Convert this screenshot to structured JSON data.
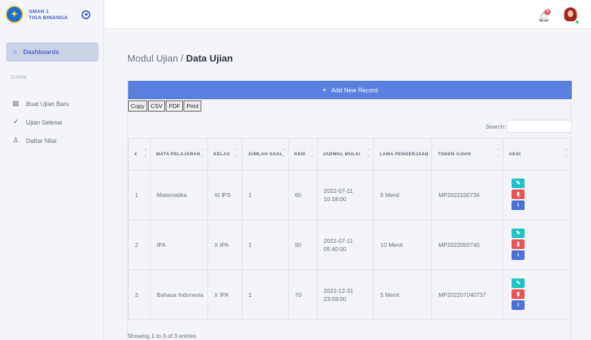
{
  "brand": {
    "line1": "SMAN 1",
    "line2": "TIGA BINANGA"
  },
  "sidebar": {
    "active": {
      "label": "Dashboards",
      "icon": "home-icon"
    },
    "section": "UJIAN",
    "items": [
      {
        "label": "Buat Ujian Baru",
        "icon": "notepad-icon"
      },
      {
        "label": "Ujian Selesai",
        "icon": "check-circle-icon"
      },
      {
        "label": "Daftar Nilai",
        "icon": "user-icon"
      }
    ]
  },
  "topbar": {
    "notification_count": "5"
  },
  "breadcrumb": {
    "parent": "Modul Ujian / ",
    "current": "Data Ujian"
  },
  "toolbar": {
    "add_label": "Add New Record"
  },
  "export": {
    "copy": "Copy",
    "csv": "CSV",
    "pdf": "PDF",
    "print": "Print"
  },
  "search": {
    "label": "Search:",
    "value": ""
  },
  "table": {
    "headers": {
      "no": "#",
      "mapel": "MATA PELAJARAN",
      "kelas": "KELAS",
      "soal": "JUMLAH SOAL",
      "kkm": "KKM",
      "jadwal": "JADWAL MULAI",
      "lama": "LAMA PENGERJAAN",
      "token": "TOKEN UJIAN",
      "aksi": "AKSI"
    },
    "rows": [
      {
        "no": "1",
        "mapel": "Matematika",
        "kelas": "XI IPS",
        "soal": "1",
        "kkm": "60",
        "jadwal_date": "2022-07-11",
        "jadwal_time": "10:18:00",
        "lama": "5 Menit",
        "token": "MP2022100734"
      },
      {
        "no": "2",
        "mapel": "IPA",
        "kelas": "X IPA",
        "soal": "1",
        "kkm": "90",
        "jadwal_date": "2022-07-11",
        "jadwal_time": "05:40:00",
        "lama": "10 Menit",
        "token": "MP2022050740"
      },
      {
        "no": "3",
        "mapel": "Bahasa Indonesia",
        "kelas": "X IPA",
        "soal": "1",
        "kkm": "70",
        "jadwal_date": "2022-12-31",
        "jadwal_time": "23:59:00",
        "lama": "5 Menit",
        "token": "MP202207040737"
      }
    ]
  },
  "footer": {
    "info": "Showing 1 to 3 of 3 entries"
  },
  "colors": {
    "accent": "#5b7fdc",
    "edit": "#1fc3c8",
    "delete": "#ea5455",
    "info": "#4c6fd8"
  }
}
